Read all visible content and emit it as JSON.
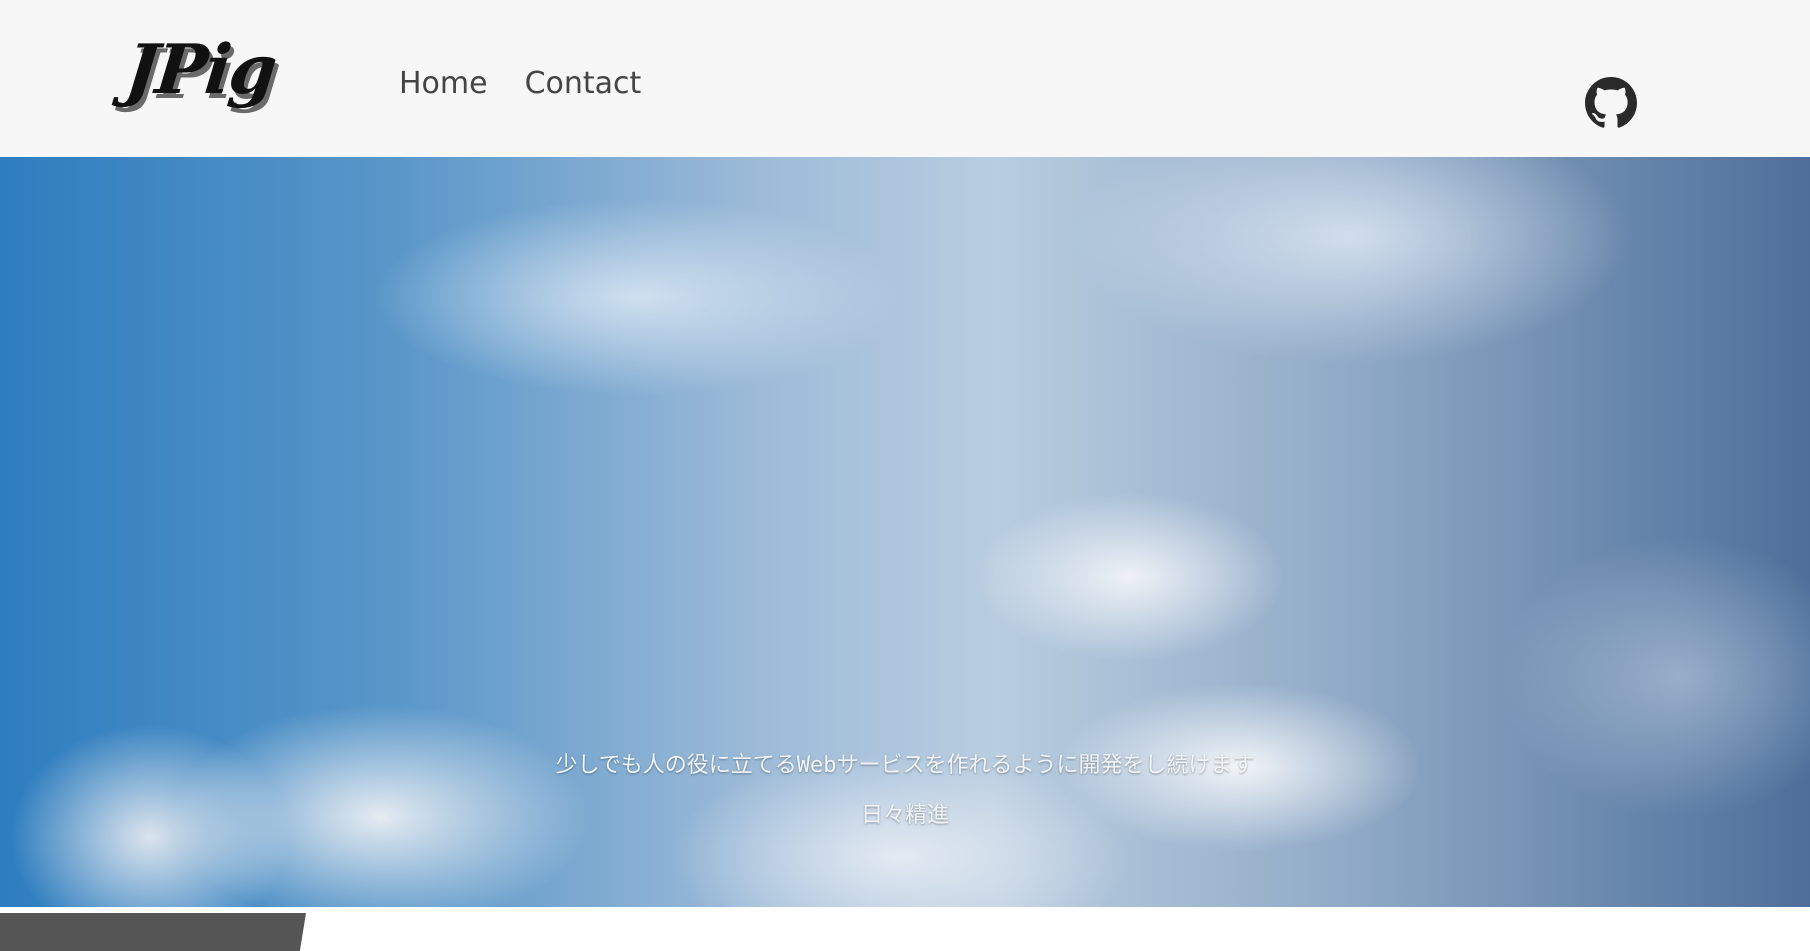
{
  "brand": {
    "logo": "JPig"
  },
  "nav": {
    "items": [
      {
        "label": "Home"
      },
      {
        "label": "Contact"
      }
    ]
  },
  "header": {
    "github_icon": "github-icon"
  },
  "hero": {
    "tagline": "少しでも人の役に立てるWebサービスを作れるように開発をし続けます",
    "motto": "日々精進"
  },
  "colors": {
    "header_bg": "#f7f7f7",
    "nav_text": "#444444",
    "sky_blue": "#2e7dbf",
    "footer_tab": "#555555"
  }
}
